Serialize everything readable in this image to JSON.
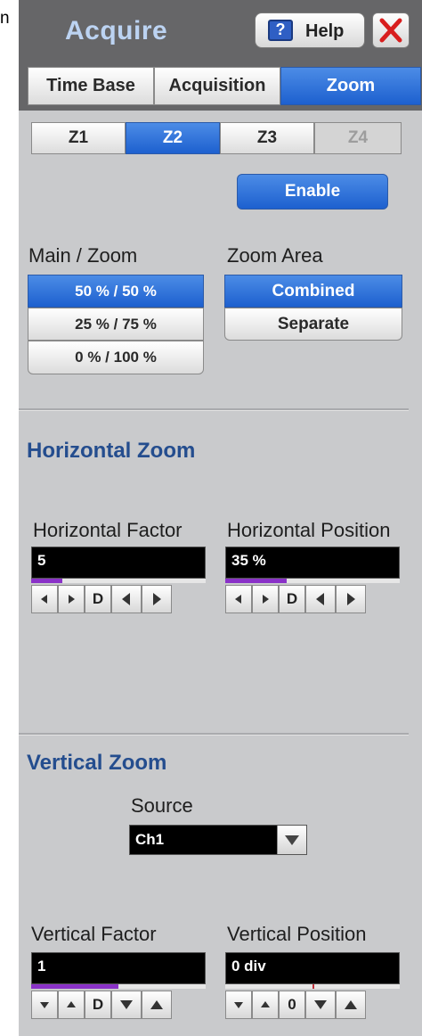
{
  "stray_text": "n",
  "header": {
    "title": "Acquire",
    "help_label": "Help",
    "help_icon_glyph": "?"
  },
  "tabs": [
    {
      "label": "Time Base",
      "active": false
    },
    {
      "label": "Acquisition",
      "active": false
    },
    {
      "label": "Zoom",
      "active": true
    }
  ],
  "zoom_selector": [
    {
      "label": "Z1",
      "state": "normal"
    },
    {
      "label": "Z2",
      "state": "active"
    },
    {
      "label": "Z3",
      "state": "normal"
    },
    {
      "label": "Z4",
      "state": "disabled"
    }
  ],
  "enable_label": "Enable",
  "main_zoom": {
    "label": "Main / Zoom",
    "options": [
      "50 % / 50 %",
      "25 % / 75 %",
      "0 % / 100 %"
    ],
    "selected": "50 % / 50 %"
  },
  "zoom_area": {
    "label": "Zoom Area",
    "options": [
      "Combined",
      "Separate"
    ],
    "selected": "Combined"
  },
  "horizontal_zoom": {
    "title": "Horizontal Zoom",
    "factor": {
      "label": "Horizontal Factor",
      "value": "5",
      "level": 0.18,
      "ctrl_d": "D"
    },
    "position": {
      "label": "Horizontal Position",
      "value": "35 %",
      "level": 0.35,
      "ctrl_d": "D"
    }
  },
  "vertical_zoom": {
    "title": "Vertical Zoom",
    "source": {
      "label": "Source",
      "value": "Ch1"
    },
    "factor": {
      "label": "Vertical Factor",
      "value": "1",
      "level": 0.5,
      "ctrl_d": "D"
    },
    "position": {
      "label": "Vertical Position",
      "value": "0 div",
      "level": 0.5,
      "ctrl_d": "0"
    }
  },
  "colors": {
    "header_bg": "#666668",
    "panel_bg": "#c9cacc",
    "active_blue": "#2f6fd8",
    "title_blue": "#244d8e",
    "level_bar": "#8a31c8",
    "close_red": "#d81e1e"
  },
  "icons": [
    "help-icon",
    "close-icon",
    "arrow-left-icon",
    "arrow-right-icon",
    "arrow-up-icon",
    "arrow-down-icon",
    "dropdown-arrow-icon"
  ]
}
